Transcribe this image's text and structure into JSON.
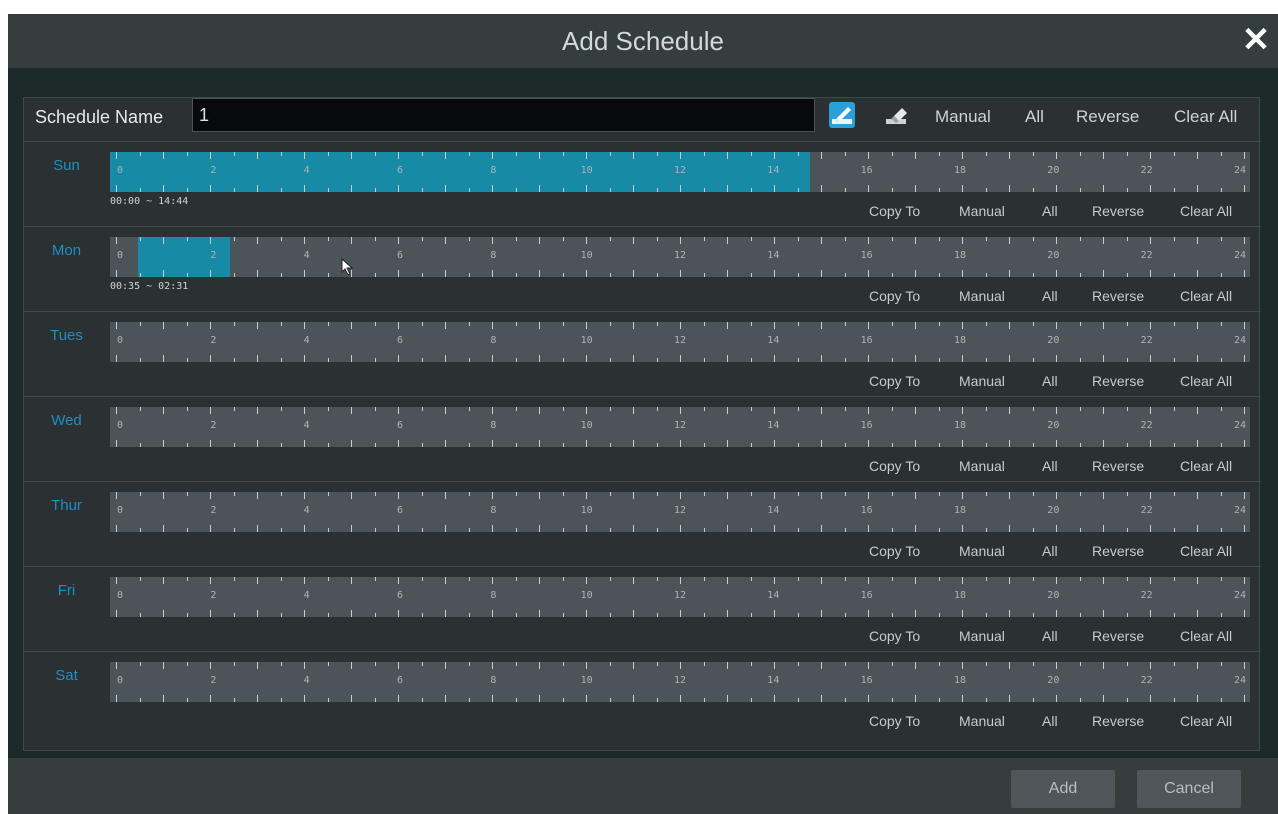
{
  "dialog": {
    "title": "Add Schedule",
    "close_icon": "close-icon"
  },
  "schedule_name": {
    "label": "Schedule Name",
    "value": "1",
    "draw_tool_icon": "pencil-draw-icon",
    "erase_tool_icon": "eraser-icon",
    "manual_label": "Manual",
    "all_label": "All",
    "reverse_label": "Reverse",
    "clear_all_label": "Clear All"
  },
  "hour_ticks": [
    "0",
    "2",
    "4",
    "6",
    "8",
    "10",
    "12",
    "14",
    "16",
    "18",
    "20",
    "22",
    "24"
  ],
  "row_actions": {
    "copy_to": "Copy To",
    "manual": "Manual",
    "all": "All",
    "reverse": "Reverse",
    "clear_all": "Clear All"
  },
  "days": [
    {
      "label": "Sun",
      "segments": [
        {
          "start_hour": 0.0,
          "end_hour": 14.73
        }
      ],
      "range_text": "00:00 ~ 14:44"
    },
    {
      "label": "Mon",
      "segments": [
        {
          "start_hour": 0.58,
          "end_hour": 2.52
        }
      ],
      "range_text": "00:35 ~ 02:31"
    },
    {
      "label": "Tues",
      "segments": [],
      "range_text": ""
    },
    {
      "label": "Wed",
      "segments": [],
      "range_text": ""
    },
    {
      "label": "Thur",
      "segments": [],
      "range_text": ""
    },
    {
      "label": "Fri",
      "segments": [],
      "range_text": ""
    },
    {
      "label": "Sat",
      "segments": [],
      "range_text": ""
    }
  ],
  "colors": {
    "selected_segment": "#178aa6",
    "day_label": "#1f8fc4",
    "active_tool": "#2a9fd8"
  },
  "footer": {
    "add_label": "Add",
    "cancel_label": "Cancel"
  }
}
